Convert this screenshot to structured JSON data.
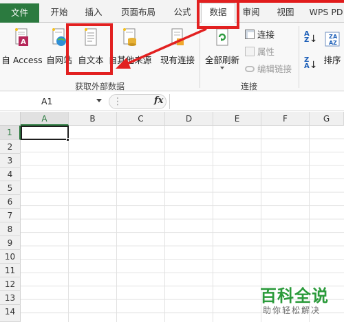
{
  "tabs": [
    {
      "label": "文件"
    },
    {
      "label": "开始"
    },
    {
      "label": "插入"
    },
    {
      "label": "页面布局"
    },
    {
      "label": "公式"
    },
    {
      "label": "数据"
    },
    {
      "label": "审阅"
    },
    {
      "label": "视图"
    },
    {
      "label": "WPS PD"
    }
  ],
  "active_tab": "数据",
  "ribbon": {
    "get_external": {
      "access": "自 Access",
      "web": "自网站",
      "text": "自文本",
      "other": "自其他来源",
      "existing": "现有连接",
      "group_label": "获取外部数据"
    },
    "connections": {
      "refresh_all": "全部刷新",
      "connections": "连接",
      "properties": "属性",
      "edit_links": "编辑链接",
      "group_label": "连接"
    },
    "sort": {
      "sort": "排序"
    }
  },
  "formula_bar": {
    "name_box": "A1",
    "fx": "fx"
  },
  "grid": {
    "columns": [
      "A",
      "B",
      "C",
      "D",
      "E",
      "F",
      "G"
    ],
    "rows": [
      "1",
      "2",
      "3",
      "4",
      "5",
      "6",
      "7",
      "8",
      "9",
      "10",
      "11",
      "12",
      "13",
      "14"
    ],
    "selected_cell": "A1"
  },
  "watermark": {
    "logo": "百科全说",
    "sub": "助你轻松解决"
  },
  "colors": {
    "file_tab": "#2b7a3f",
    "highlight": "#e22020",
    "watermark": "#2a9a3a"
  }
}
